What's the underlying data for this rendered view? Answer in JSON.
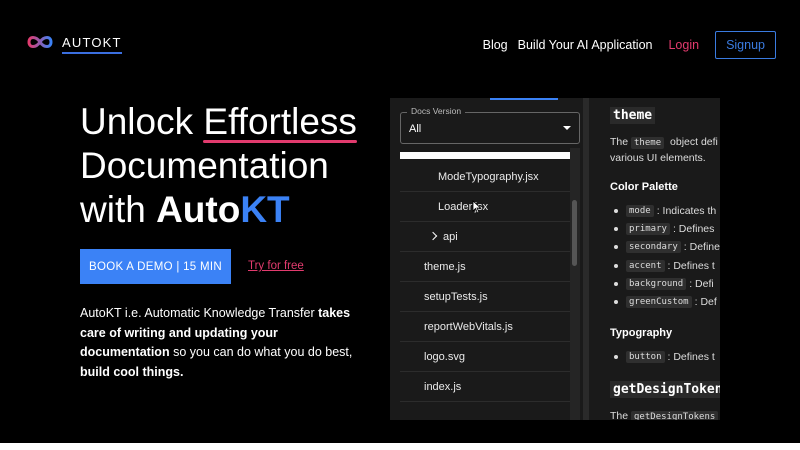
{
  "brand": {
    "name": "AUTOKT",
    "icon": "infinity-logo-icon",
    "accent": "#3b82f6",
    "pink": "#e23b6e"
  },
  "nav": {
    "blog": "Blog",
    "build": "Build Your AI Application",
    "login": "Login",
    "signup": "Signup"
  },
  "hero": {
    "line1_pre": "Unlock ",
    "line1_hl": "Effortless",
    "line2": "Documentation",
    "line3_pre": "with ",
    "line3_auto": "Auto",
    "line3_kt": "KT",
    "demo_button": "BOOK A DEMO | 15 MIN",
    "try_link": "Try for free",
    "desc_1": "AutoKT i.e. Automatic Knowledge Transfer ",
    "desc_2": "takes care of writing and updating your documentation",
    "desc_3": " so you can do what you do best, ",
    "desc_4": "build cool things."
  },
  "docs": {
    "select_label": "Docs Version",
    "select_value": "All",
    "tree": [
      {
        "label": "ModeTypography.jsx"
      },
      {
        "label": "Loader.jsx"
      },
      {
        "label": "api"
      },
      {
        "label": "theme.js"
      },
      {
        "label": "setupTests.js"
      },
      {
        "label": "reportWebVitals.js"
      },
      {
        "label": "logo.svg"
      },
      {
        "label": "index.js"
      }
    ],
    "content": {
      "theme_heading": "theme",
      "p1_pre": "The ",
      "p1_code": "theme",
      "p1_post": " object defi",
      "p1_line2": "various UI elements.",
      "color_palette": "Color Palette",
      "palette_items": [
        {
          "code": "mode",
          "text": ": Indicates th"
        },
        {
          "code": "primary",
          "text": ": Defines"
        },
        {
          "code": "secondary",
          "text": ": Define"
        },
        {
          "code": "accent",
          "text": ": Defines t"
        },
        {
          "code": "background",
          "text": ": Defi"
        },
        {
          "code": "greenCustom",
          "text": ": Def"
        }
      ],
      "typography": "Typography",
      "typo_items": [
        {
          "code": "button",
          "text": ": Defines t"
        }
      ],
      "design_heading": "getDesignToken",
      "p2_pre": "The ",
      "p2_code": "getDesignTokens"
    }
  }
}
